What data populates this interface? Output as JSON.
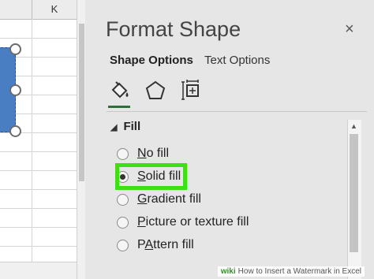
{
  "sheet": {
    "columns": [
      "",
      "K"
    ]
  },
  "pane": {
    "title": "Format Shape",
    "close_glyph": "×",
    "tabs": [
      {
        "label": "Shape Options",
        "active": true
      },
      {
        "label": "Text Options",
        "active": false
      }
    ],
    "icons": [
      {
        "name": "fill-line-icon",
        "active": true
      },
      {
        "name": "effects-icon",
        "active": false
      },
      {
        "name": "size-properties-icon",
        "active": false
      }
    ],
    "section": {
      "arrow": "◢",
      "title": "Fill"
    },
    "fill_options": [
      {
        "accel": "N",
        "rest": "o fill",
        "selected": false
      },
      {
        "accel": "S",
        "rest": "olid fill",
        "selected": true
      },
      {
        "accel": "G",
        "rest": "radient fill",
        "selected": false
      },
      {
        "accel": "P",
        "rest": "icture or texture fill",
        "selected": false
      },
      {
        "accel": "A",
        "rest": "",
        "prefix": "P",
        "suffix": "ttern fill",
        "selected": false
      }
    ]
  },
  "watermark": {
    "logo": "wiki",
    "text": "How to Insert a Watermark in Excel"
  },
  "colors": {
    "highlight": "#3ee015",
    "shape_fill": "#4a7ec3"
  }
}
